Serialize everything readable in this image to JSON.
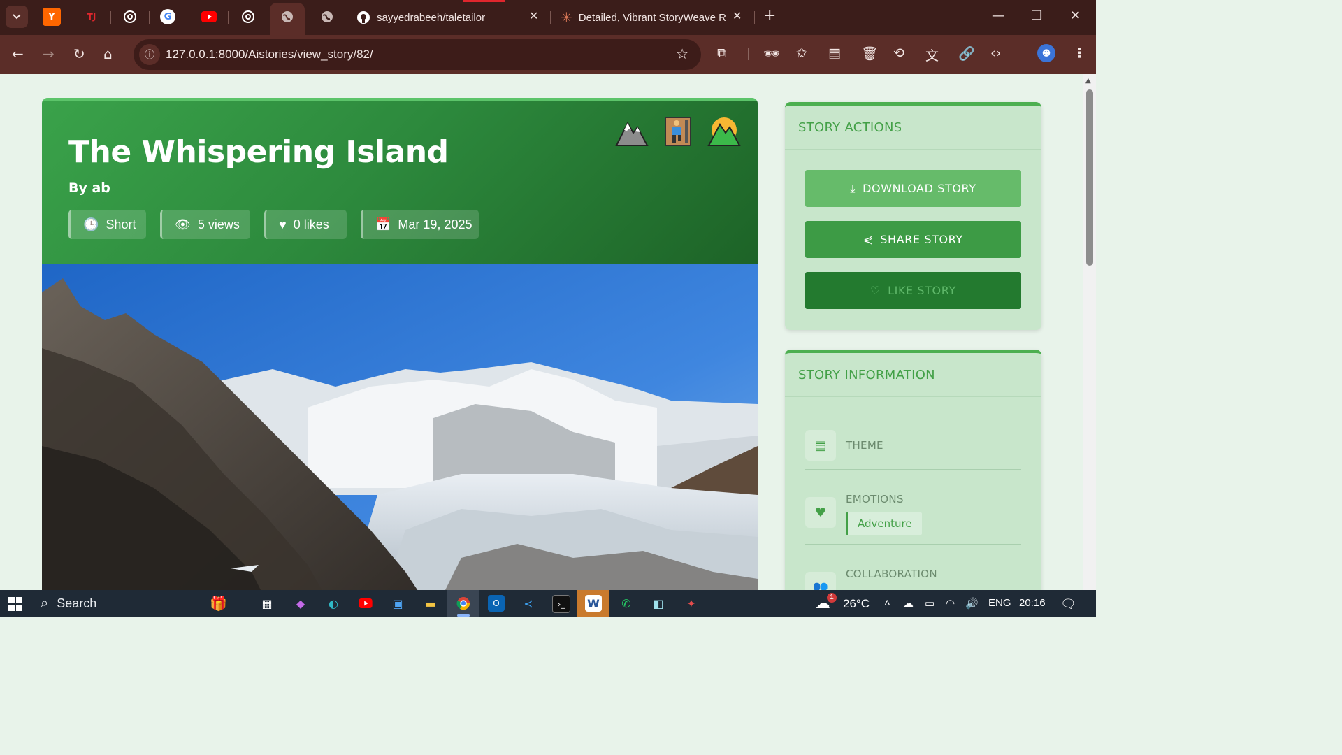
{
  "browser": {
    "tabs": [
      {
        "title": "sayyedrabeeh/taletailor",
        "icon": "github-icon"
      },
      {
        "title": "Detailed, Vibrant StoryWeave R",
        "icon": "claude-icon"
      }
    ],
    "new_tab_label": "+",
    "url": "127.0.0.1:8000/Aistories/view_story/82/"
  },
  "story": {
    "title": "The Whispering Island",
    "author": "By ab",
    "length": "Short",
    "views": "5 views",
    "likes": "0 likes",
    "date": "Mar 19, 2025",
    "emojis": [
      "mountain-icon",
      "climber-icon",
      "hills-icon"
    ]
  },
  "actions": {
    "heading": "STORY ACTIONS",
    "download_label": "DOWNLOAD STORY",
    "share_label": "SHARE STORY",
    "like_label": "LIKE STORY"
  },
  "info": {
    "heading": "STORY INFORMATION",
    "theme_label": "THEME",
    "emotions_label": "EMOTIONS",
    "emotion_tag": "Adventure",
    "collaboration_label": "COLLABORATION"
  },
  "taskbar": {
    "search_label": "Search",
    "weather": "26°C",
    "weather_badge": "1",
    "language": "ENG",
    "time": "20:16"
  },
  "colors": {
    "chrome_dark": "#3b1d1a",
    "chrome_toolbar": "#5b2d28",
    "hero_green": "#2d8a3d",
    "accent_green": "#43a047",
    "panel_bg": "#c8e6cb",
    "download_btn": "#66bb6a",
    "share_btn": "#3d9b45",
    "like_btn": "#237a2f"
  }
}
